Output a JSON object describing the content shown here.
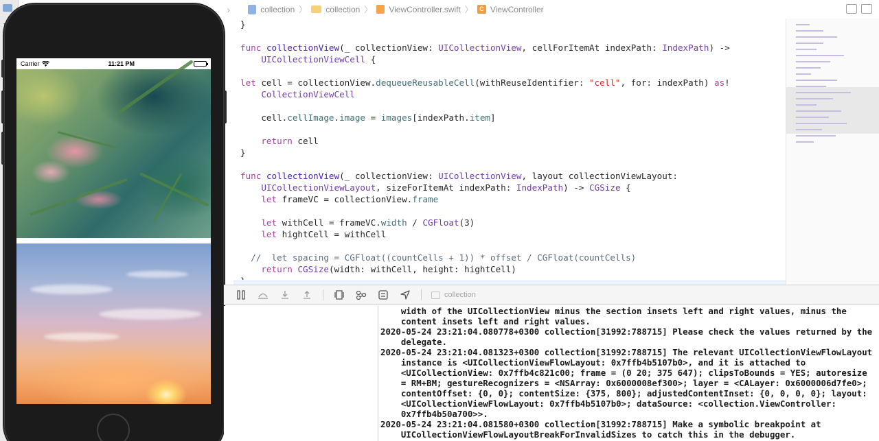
{
  "jump_bar": {
    "nav_arrows": "‹ ›",
    "crumbs": [
      "collection",
      "collection",
      "ViewController.swift",
      "ViewController"
    ],
    "class_badge": "C"
  },
  "simulator": {
    "status_bar": {
      "carrier": "Carrier",
      "time": "11:21 PM"
    }
  },
  "code": [
    "}",
    "",
    "<span class='k'>func</span> <span class='f'>collectionView</span>(_ collectionView: <span class='t'>UICollectionView</span>, cellForItemAt indexPath: <span class='t'>IndexPath</span>) ->",
    "    <span class='t'>UICollectionViewCell</span> {",
    "",
    "<span class='k'>let</span> cell = collectionView.<span class='p'>dequeueReusableCell</span>(withReuseIdentifier: <span class='s'>\"cell\"</span>, for: indexPath) <span class='k'>as</span>!",
    "    <span class='t'>CollectionViewCell</span>",
    "",
    "    cell.<span class='p'>cellImage</span>.<span class='p'>image</span> = <span class='p'>images</span>[indexPath.<span class='p'>item</span>]",
    "",
    "    <span class='k'>return</span> cell",
    "}",
    "",
    "<span class='k'>func</span> <span class='f'>collectionView</span>(_ collectionView: <span class='t'>UICollectionView</span>, layout collectionViewLayout:",
    "    <span class='t'>UICollectionViewLayout</span>, sizeForItemAt indexPath: <span class='t'>IndexPath</span>) -> <span class='t'>CGSize</span> {",
    "    <span class='k'>let</span> frameVC = collectionView.<span class='p'>frame</span>",
    "",
    "    <span class='k'>let</span> withCell = frameVC.<span class='p'>width</span> / <span class='t'>CGFloat</span>(3)",
    "    <span class='k'>let</span> hightCell = withCell",
    "",
    "  <span class='c'>//  let spacing = CGFloat((countCells + 1)) * offset / CGFloat(countCells)</span>",
    "    <span class='k'>return</span> <span class='t'>CGSize</span>(width: withCell, height: hightCell)",
    "}"
  ],
  "debug_bar": {
    "target": "collection"
  },
  "console": [
    "    width of the UICollectionView minus the section insets left and right values, minus the",
    "    content insets left and right values.",
    "2020-05-24 23:21:04.080778+0300 collection[31992:788715] Please check the values returned by the",
    "    delegate.",
    "2020-05-24 23:21:04.081323+0300 collection[31992:788715] The relevant UICollectionViewFlowLayout",
    "    instance is <UICollectionViewFlowLayout: 0x7ffb4b5107b0>, and it is attached to",
    "    <UICollectionView: 0x7ffb4c821c00; frame = (0 20; 375 647); clipsToBounds = YES; autoresize",
    "    = RM+BM; gestureRecognizers = <NSArray: 0x6000008ef300>; layer = <CALayer: 0x6000006d7fe0>;",
    "    contentOffset: {0, 0}; contentSize: {375, 800}; adjustedContentInset: {0, 0, 0, 0}; layout:",
    "    <UICollectionViewFlowLayout: 0x7ffb4b5107b0>; dataSource: <collection.ViewController:",
    "    0x7ffb4b50a700>>.",
    "2020-05-24 23:21:04.081580+0300 collection[31992:788715] Make a symbolic breakpoint at",
    "    UICollectionViewFlowLayoutBreakForInvalidSizes to catch this in the debugger."
  ],
  "colors": {
    "keyword": "#ad3da4",
    "function": "#4b21b0",
    "type": "#703daa",
    "string": "#d12f1b",
    "property": "#3e6d74",
    "comment": "#5d6c79"
  }
}
